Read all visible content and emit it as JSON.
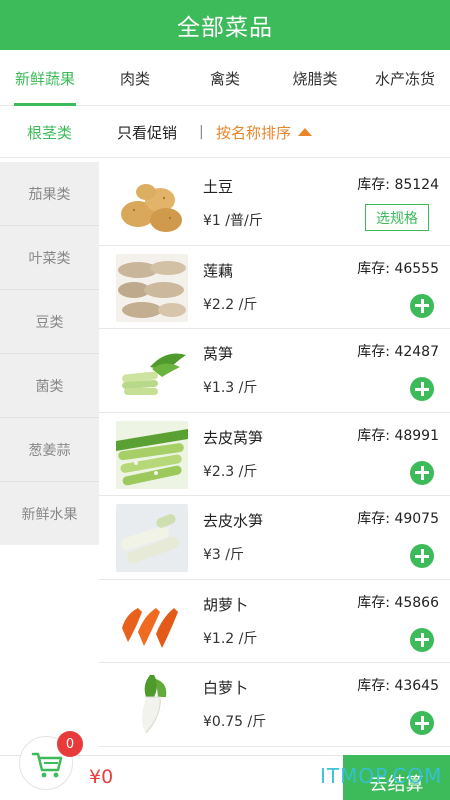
{
  "header": {
    "title": "全部菜品"
  },
  "category_tabs": [
    {
      "label": "新鲜蔬果",
      "active": true
    },
    {
      "label": "肉类",
      "active": false
    },
    {
      "label": "禽类",
      "active": false
    },
    {
      "label": "烧腊类",
      "active": false
    },
    {
      "label": "水产冻货",
      "active": false
    }
  ],
  "filters": {
    "active_subcategory": "根茎类",
    "promo_only": "只看促销",
    "separator": "|",
    "sort_label": "按名称排序",
    "sort_icon": "triangle-up-icon"
  },
  "sidebar": {
    "items": [
      "茄果类",
      "叶菜类",
      "豆类",
      "菌类",
      "葱姜蒜",
      "新鲜水果"
    ]
  },
  "products": [
    {
      "name": "土豆",
      "price": "¥1 /普/斤",
      "stock": "库存:  85124",
      "action": "选规格",
      "image": "potato"
    },
    {
      "name": "莲藕",
      "price": "¥2.2 /斤",
      "stock": "库存:  46555",
      "action": "add",
      "image": "lotus-root"
    },
    {
      "name": "莴笋",
      "price": "¥1.3 /斤",
      "stock": "库存:  42487",
      "action": "add",
      "image": "lettuce-stem"
    },
    {
      "name": "去皮莴笋",
      "price": "¥2.3 /斤",
      "stock": "库存:  48991",
      "action": "add",
      "image": "peeled-lettuce-stem"
    },
    {
      "name": "去皮水笋",
      "price": "¥3 /斤",
      "stock": "库存:  49075",
      "action": "add",
      "image": "peeled-water-bamboo"
    },
    {
      "name": "胡萝卜",
      "price": "¥1.2 /斤",
      "stock": "库存:  45866",
      "action": "add",
      "image": "carrot"
    },
    {
      "name": "白萝卜",
      "price": "¥0.75 /斤",
      "stock": "库存:  43645",
      "action": "add",
      "image": "white-radish"
    }
  ],
  "cart": {
    "badge": "0",
    "total": "¥0",
    "icon": "shopping-cart-icon"
  },
  "checkout": {
    "label": "去结算"
  },
  "watermark": "ITMOP.COM",
  "colors": {
    "primary": "#3dbb5a",
    "sort_accent": "#e8862c",
    "price_total": "#e84040",
    "badge": "#e83a3a"
  }
}
